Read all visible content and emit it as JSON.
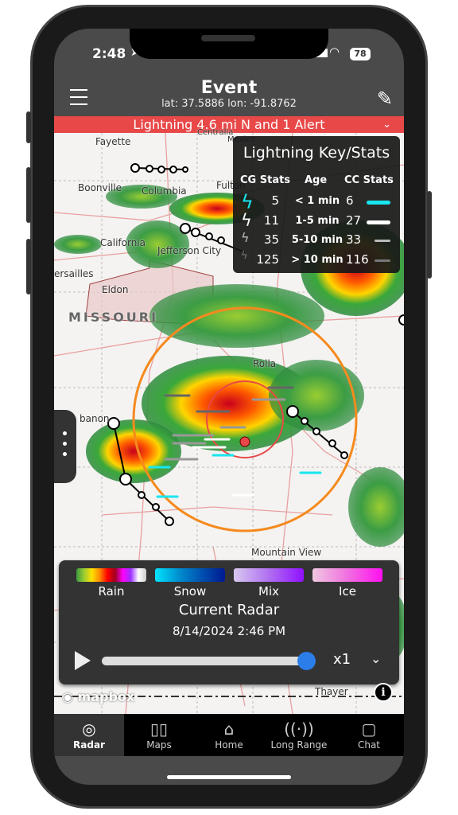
{
  "status": {
    "time": "2:48",
    "battery": "78"
  },
  "header": {
    "title": "Event",
    "coords": "lat: 37.5886 lon: -91.8762"
  },
  "alert": {
    "text": "Lightning 4.6 mi N and 1 Alert",
    "color": "#e84848"
  },
  "map": {
    "labels": [
      "Fayette",
      "Boonville",
      "Columbia",
      "Centralia",
      "Mexico",
      "Fulton",
      "California",
      "Jefferson City",
      "ersailles",
      "Eldon",
      "MISSOURI",
      "Rolla",
      "banon",
      "Mountain View",
      "Thayer"
    ],
    "attribution": "mapbox"
  },
  "lightning_key": {
    "title": "Lightning Key/Stats",
    "headers": [
      "CG Stats",
      "Age",
      "CC Stats"
    ],
    "rows": [
      {
        "cg": "5",
        "age": "< 1 min",
        "cc": "6",
        "color": "#19e6f0"
      },
      {
        "cg": "11",
        "age": "1-5 min",
        "cc": "27",
        "color": "#ffffff"
      },
      {
        "cg": "35",
        "age": "5-10 min",
        "cc": "33",
        "color": "#bbbbbb"
      },
      {
        "cg": "125",
        "age": "> 10 min",
        "cc": "116",
        "color": "#777777"
      }
    ]
  },
  "legend": {
    "items": [
      "Rain",
      "Snow",
      "Mix",
      "Ice"
    ],
    "title": "Current Radar",
    "datetime": "8/14/2024 2:46 PM",
    "speed": "x1",
    "progress": 1.0
  },
  "tabs": [
    {
      "label": "Radar",
      "icon": "radar-icon",
      "active": true
    },
    {
      "label": "Maps",
      "icon": "map-icon"
    },
    {
      "label": "Home",
      "icon": "home-icon"
    },
    {
      "label": "Long Range",
      "icon": "wifi-icon"
    },
    {
      "label": "Chat",
      "icon": "chat-icon"
    }
  ]
}
